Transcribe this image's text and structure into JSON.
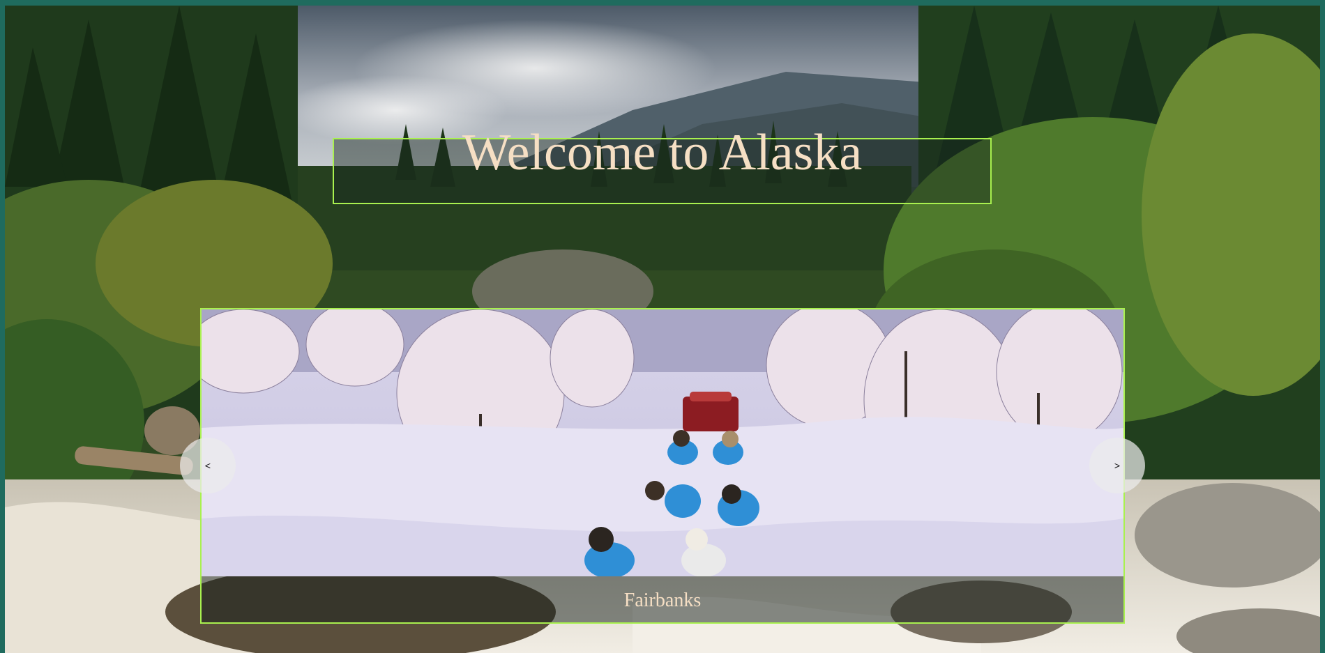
{
  "page": {
    "title": "Welcome to Alaska"
  },
  "carousel": {
    "current_caption": "Fairbanks",
    "prev_label": "<",
    "next_label": ">"
  },
  "colors": {
    "frame_border": "#1f6b5e",
    "accent_border": "#a9f14f",
    "title_text": "#f6dfc4"
  },
  "images": {
    "background": "forest-river-mountains-photo",
    "slide": "sled-dogs-snowy-forest-photo"
  }
}
